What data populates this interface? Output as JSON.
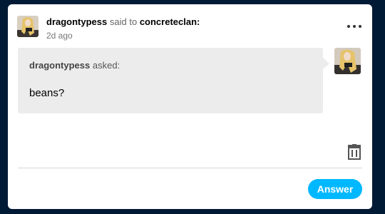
{
  "post": {
    "author": "dragontypess",
    "said_to": "said to",
    "recipient": "concreteclan:",
    "time_ago": "2d ago",
    "more_icon": "more-horizontal-icon"
  },
  "ask": {
    "asker": "dragontypess",
    "asked_label": "asked:",
    "question": "beans?"
  },
  "actions": {
    "delete_icon": "trash-icon",
    "answer_label": "Answer"
  },
  "colors": {
    "page_background": "#001935",
    "answer_button": "#00b8ff",
    "bubble": "#ececec"
  }
}
